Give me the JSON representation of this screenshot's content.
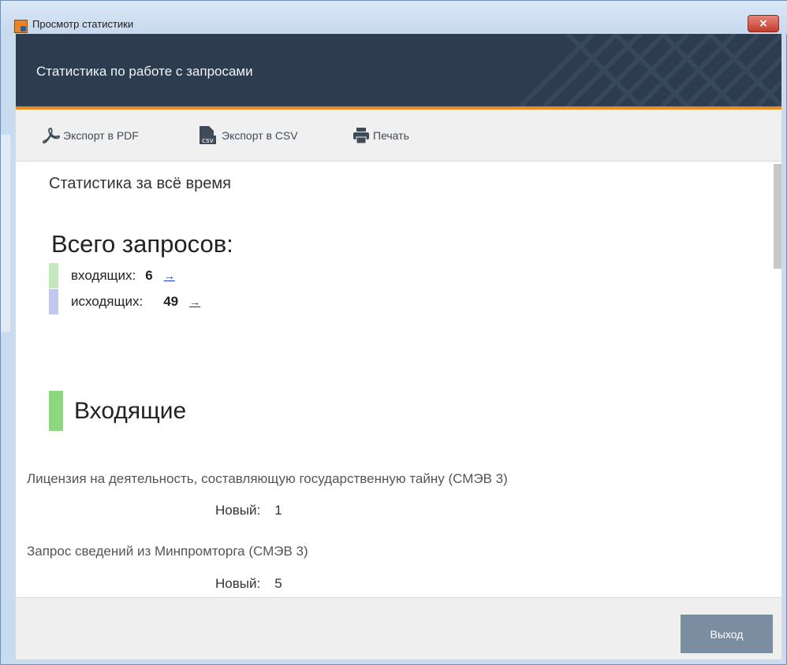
{
  "window": {
    "title": "Просмотр статистики",
    "close_label": "×"
  },
  "header": {
    "title": "Статистика по работе с запросами"
  },
  "toolbar": {
    "export_pdf": "Экспорт в PDF",
    "export_csv": "Экспорт в CSV",
    "print": "Печать",
    "csv_icon_text": "csv"
  },
  "content": {
    "period": "Статистика за всё время",
    "total_heading": "Всего запросов:",
    "incoming": {
      "label": "входящих:",
      "count": "6",
      "link": "→"
    },
    "outgoing": {
      "label": "исходящих:",
      "count": "49",
      "link": "→"
    },
    "section_title": "Входящие",
    "items": [
      {
        "title": "Лицензия на деятельность, составляющую государственную тайну (СМЭВ 3)",
        "status": "Новый:",
        "count": "1"
      },
      {
        "title": "Запрос сведений из Минпромторга (СМЭВ 3)",
        "status": "Новый:",
        "count": "5"
      }
    ]
  },
  "footer": {
    "exit_label": "Выход"
  },
  "colors": {
    "header_bg": "#2d3c4f",
    "accent": "#ef8a1c",
    "incoming_swatch": "#c3e8bd",
    "outgoing_swatch": "#bfc8ee",
    "section_bar": "#8ed680",
    "exit_button": "#7b8ea1"
  }
}
